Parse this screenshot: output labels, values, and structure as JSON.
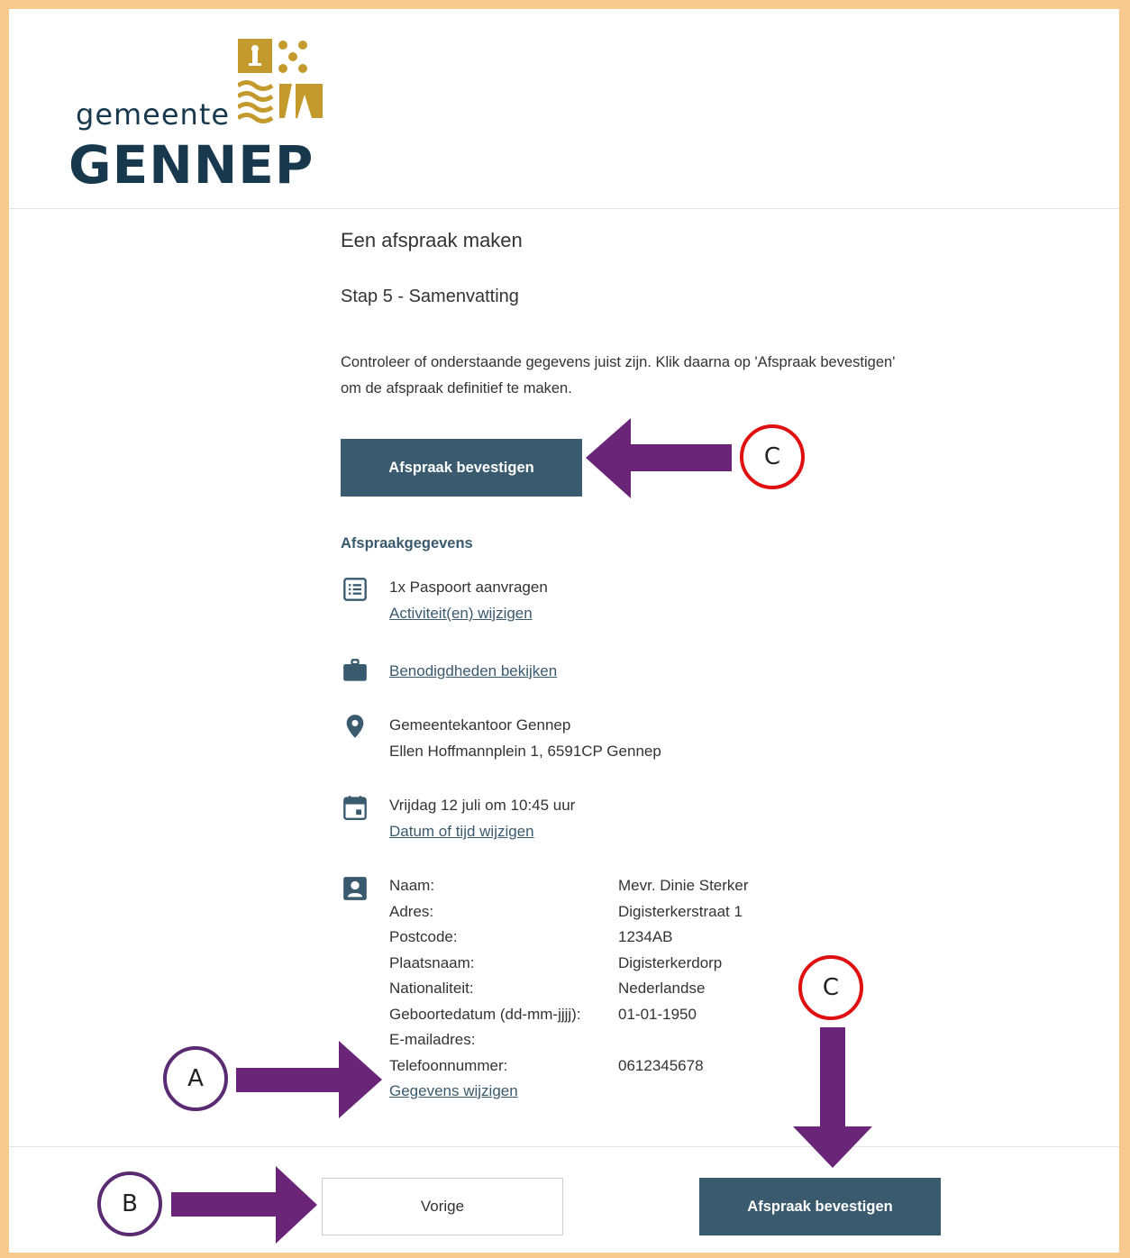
{
  "logo": {
    "word_small": "gemeente",
    "word_big": "GENNEP"
  },
  "page": {
    "title": "Een afspraak maken",
    "step": "Stap 5 - Samenvatting",
    "intro": "Controleer of onderstaande gegevens juist zijn. Klik daarna op 'Afspraak bevestigen' om de afspraak definitief te maken.",
    "confirm_label": "Afspraak bevestigen"
  },
  "appointment": {
    "heading": "Afspraakgegevens",
    "activity": "1x Paspoort aanvragen",
    "activity_link": "Activiteit(en) wijzigen",
    "requirements_link": "Benodigdheden bekijken",
    "location_name": "Gemeentekantoor Gennep",
    "location_address": "Ellen Hoffmannplein 1, 6591CP Gennep",
    "datetime": "Vrijdag 12 juli om 10:45 uur",
    "datetime_link": "Datum of tijd wijzigen"
  },
  "personal": {
    "rows": [
      {
        "label": "Naam:",
        "value": "Mevr. Dinie Sterker"
      },
      {
        "label": "Adres:",
        "value": "Digisterkerstraat 1"
      },
      {
        "label": "Postcode:",
        "value": "1234AB"
      },
      {
        "label": "Plaatsnaam:",
        "value": "Digisterkerdorp"
      },
      {
        "label": "Nationaliteit:",
        "value": "Nederlandse"
      },
      {
        "label": "Geboortedatum (dd-mm-jjjj):",
        "value": "01-01-1950"
      },
      {
        "label": "E-mailadres:",
        "value": ""
      },
      {
        "label": "Telefoonnummer:",
        "value": "0612345678"
      }
    ],
    "edit_link": "Gegevens wijzigen"
  },
  "footer": {
    "prev_label": "Vorige",
    "confirm_label": "Afspraak bevestigen"
  },
  "annotations": {
    "a": "A",
    "b": "B",
    "c": "C"
  },
  "colors": {
    "accent": "#3a5a6e",
    "arrow": "#6a2478",
    "circle_red": "#e01010",
    "circle_purple": "#5a2a73",
    "logo_gold": "#c49a2c",
    "logo_navy": "#17384d",
    "frame": "#f7c98f"
  }
}
